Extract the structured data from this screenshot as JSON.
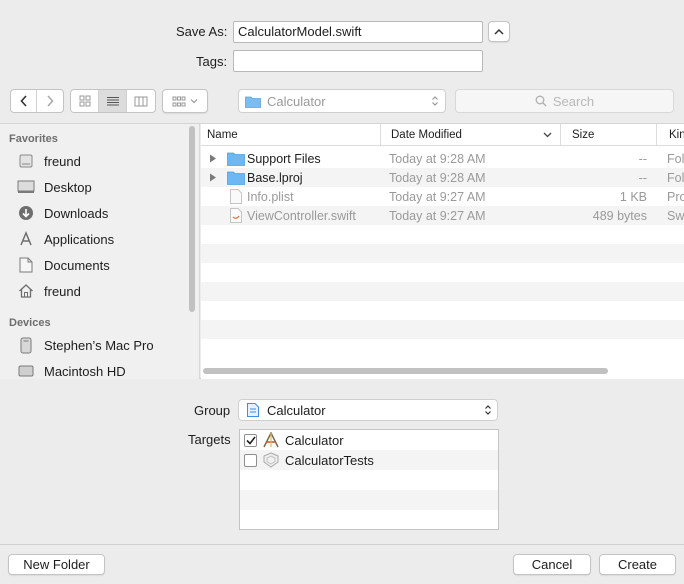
{
  "save_as": {
    "label": "Save As:",
    "value": "CalculatorModel.swift"
  },
  "tags": {
    "label": "Tags:",
    "value": ""
  },
  "toolbar": {
    "location": "Calculator",
    "search_placeholder": "Search"
  },
  "sidebar": {
    "favorites_header": "Favorites",
    "favorites": [
      {
        "label": "freund",
        "icon": "hard-drive-icon"
      },
      {
        "label": "Desktop",
        "icon": "desktop-icon"
      },
      {
        "label": "Downloads",
        "icon": "downloads-icon"
      },
      {
        "label": "Applications",
        "icon": "applications-icon"
      },
      {
        "label": "Documents",
        "icon": "documents-icon"
      },
      {
        "label": "freund",
        "icon": "home-icon"
      }
    ],
    "devices_header": "Devices",
    "devices": [
      {
        "label": "Stephen’s Mac Pro",
        "icon": "computer-icon"
      },
      {
        "label": "Macintosh HD",
        "icon": "hard-drive-icon"
      }
    ]
  },
  "file_list": {
    "columns": [
      "Name",
      "Date Modified",
      "Size",
      "Kin"
    ],
    "rows": [
      {
        "name": "Support Files",
        "date": "Today at 9:28 AM",
        "size": "--",
        "kind": "Fol",
        "type": "folder",
        "dim": false
      },
      {
        "name": "Base.lproj",
        "date": "Today at 9:28 AM",
        "size": "--",
        "kind": "Fol",
        "type": "folder",
        "dim": false
      },
      {
        "name": "Info.plist",
        "date": "Today at 9:27 AM",
        "size": "1 KB",
        "kind": "Pro",
        "type": "file",
        "dim": true
      },
      {
        "name": "ViewController.swift",
        "date": "Today at 9:27 AM",
        "size": "489 bytes",
        "kind": "Sw",
        "type": "swift-file",
        "dim": true
      }
    ]
  },
  "group": {
    "label": "Group",
    "value": "Calculator"
  },
  "targets": {
    "label": "Targets",
    "items": [
      {
        "label": "Calculator",
        "checked": true
      },
      {
        "label": "CalculatorTests",
        "checked": false
      }
    ]
  },
  "buttons": {
    "new_folder": "New Folder",
    "cancel": "Cancel",
    "create": "Create"
  },
  "colors": {
    "accent": "#3d8ee8",
    "folder": "#5eb2f2",
    "sidebar_bg": "#f0f0f0",
    "panel_bg": "#ececec"
  }
}
